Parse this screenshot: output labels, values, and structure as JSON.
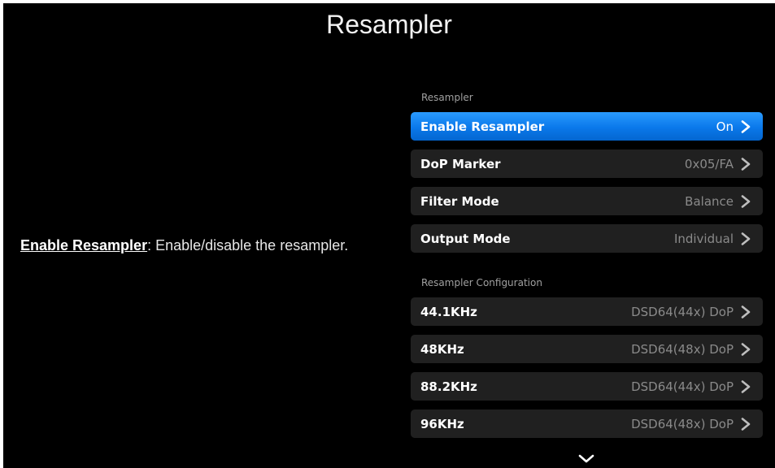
{
  "title": "Resampler",
  "help": {
    "term": "Enable Resampler",
    "description": ": Enable/disable the resampler."
  },
  "sections": [
    {
      "header": "Resampler",
      "items": [
        {
          "label": "Enable Resampler",
          "value": "On",
          "selected": true
        },
        {
          "label": "DoP Marker",
          "value": "0x05/FA",
          "selected": false
        },
        {
          "label": "Filter Mode",
          "value": "Balance",
          "selected": false
        },
        {
          "label": "Output Mode",
          "value": "Individual",
          "selected": false
        }
      ]
    },
    {
      "header": "Resampler Configuration",
      "items": [
        {
          "label": "44.1KHz",
          "value": "DSD64(44x) DoP",
          "selected": false
        },
        {
          "label": "48KHz",
          "value": "DSD64(48x) DoP",
          "selected": false
        },
        {
          "label": "88.2KHz",
          "value": "DSD64(44x) DoP",
          "selected": false
        },
        {
          "label": "96KHz",
          "value": "DSD64(48x) DoP",
          "selected": false
        }
      ]
    }
  ],
  "icons": {
    "row_chevron": "chevron-right-icon",
    "scroll": "chevron-down-icon"
  },
  "colors": {
    "background": "#000000",
    "row": "#202020",
    "selected": "#0a78ea",
    "value_text": "#8a8a8a",
    "section_header": "#a0a0a0"
  }
}
